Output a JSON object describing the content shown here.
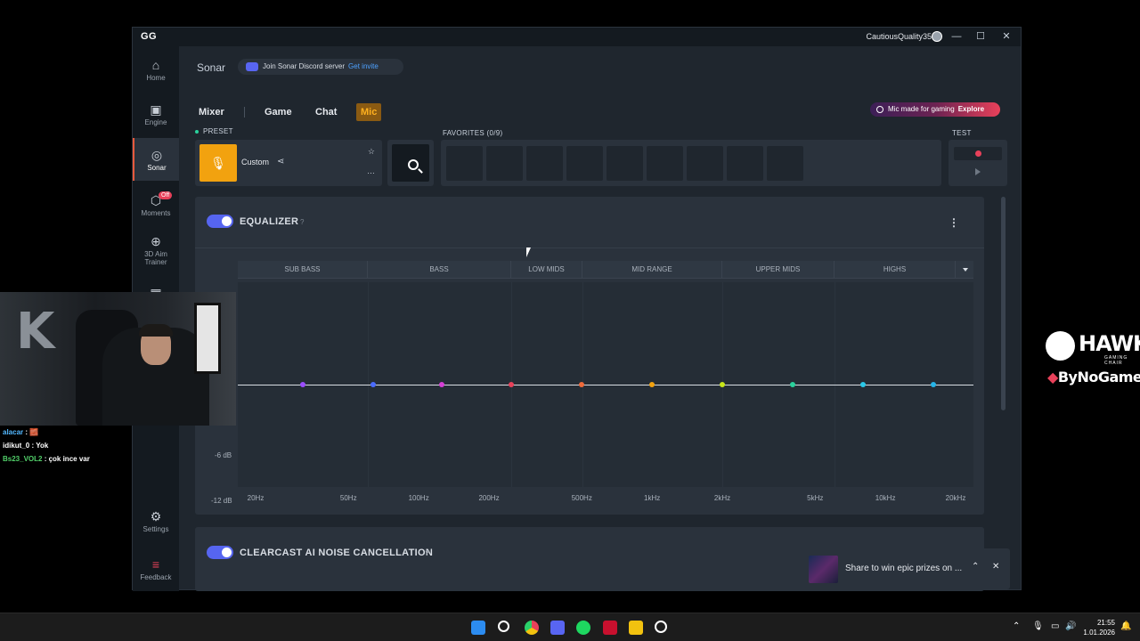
{
  "titlebar": {
    "logo": "GG",
    "username": "CautiousQuality35",
    "minimize": "—",
    "maximize": "☐",
    "close": "✕"
  },
  "nav": {
    "home": "Home",
    "engine": "Engine",
    "sonar": "Sonar",
    "moments": "Moments",
    "moments_badge": "Off",
    "aim1": "3D Aim",
    "aim2": "Trainer",
    "settings": "Settings",
    "feedback": "Feedback"
  },
  "header": {
    "title": "Sonar",
    "discord_text": "Join Sonar Discord server",
    "discord_link": "Get invite"
  },
  "tabs": {
    "mixer": "Mixer",
    "game": "Game",
    "chat": "Chat",
    "mic": "Mic"
  },
  "promo": {
    "text": "Mic made for gaming",
    "cta": "Explore"
  },
  "preset": {
    "label": "PRESET",
    "name": "Custom",
    "share_icon": "share-icon",
    "star": "☆",
    "more": "…"
  },
  "favorites": {
    "label": "FAVORITES (0/9)"
  },
  "test": {
    "label": "TEST"
  },
  "equalizer": {
    "title": "EQUALIZER",
    "help": "?",
    "more": "⋮",
    "bands": [
      "SUB BASS",
      "BASS",
      "LOW MIDS",
      "MID RANGE",
      "UPPER MIDS",
      "HIGHS"
    ],
    "y_labels": [
      "-6 dB",
      "-12 dB"
    ],
    "x_labels": [
      "20Hz",
      "50Hz",
      "100Hz",
      "200Hz",
      "500Hz",
      "1kHz",
      "2kHz",
      "5kHz",
      "10kHz",
      "20kHz"
    ],
    "points": [
      {
        "freq": "32Hz",
        "gain_db": 0,
        "color": "#9b4dff"
      },
      {
        "freq": "64Hz",
        "gain_db": 0,
        "color": "#4a6bff"
      },
      {
        "freq": "125Hz",
        "gain_db": 0,
        "color": "#d63fd6"
      },
      {
        "freq": "250Hz",
        "gain_db": 0,
        "color": "#e8415a"
      },
      {
        "freq": "500Hz",
        "gain_db": 0,
        "color": "#f06a3a"
      },
      {
        "freq": "1kHz",
        "gain_db": 0,
        "color": "#f2a20f"
      },
      {
        "freq": "2kHz",
        "gain_db": 0,
        "color": "#c8e619"
      },
      {
        "freq": "4kHz",
        "gain_db": 0,
        "color": "#2ad19c"
      },
      {
        "freq": "8kHz",
        "gain_db": 0,
        "color": "#2ac8e8"
      },
      {
        "freq": "16kHz",
        "gain_db": 0,
        "color": "#26b4e8"
      }
    ]
  },
  "clearcast": {
    "title": "CLEARCAST AI NOISE CANCELLATION",
    "help": "?"
  },
  "toast": {
    "text": "Share to win epic prizes on ...",
    "up": "⌃",
    "close": "✕"
  },
  "chat_lines": [
    {
      "user": "alacar",
      "msg": " : 🧱"
    },
    {
      "user": "idikut_0",
      "msg": " : Yok"
    },
    {
      "user": "Bs23_VOL2",
      "msg": " : çok ince var"
    }
  ],
  "overlay": {
    "hawk": "HAWK",
    "hawk_sub": "GAMING CHAIR",
    "bynogame": "ByNoGame"
  },
  "taskbar": {
    "time": "21:55",
    "date": "1.01.2026"
  }
}
